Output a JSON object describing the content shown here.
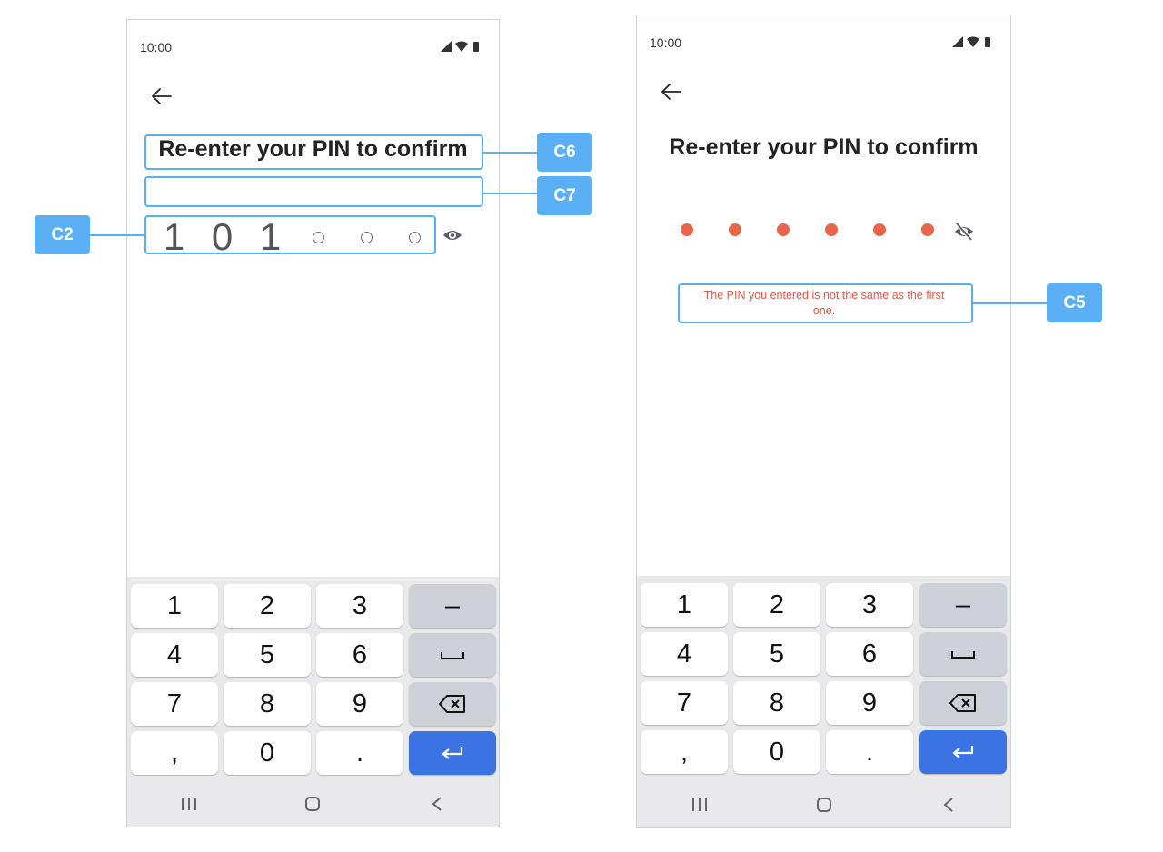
{
  "left_screen": {
    "status_time": "10:00",
    "title": "Re-enter your PIN to confirm",
    "pin_digits": [
      "1",
      "0",
      "1"
    ],
    "empty_slot_count": 3
  },
  "right_screen": {
    "status_time": "10:00",
    "title": "Re-enter your PIN to confirm",
    "masked_slot_count": 6,
    "error_message_line1": "The PIN you entered is not the same as the first",
    "error_message_line2": "one."
  },
  "keyboard": {
    "rows": [
      [
        "1",
        "2",
        "3",
        "–"
      ],
      [
        "4",
        "5",
        "6",
        "space-icon"
      ],
      [
        "7",
        "8",
        "9",
        "backspace-icon"
      ],
      [
        ",",
        "0",
        ".",
        "enter-icon"
      ]
    ]
  },
  "annotations": {
    "c6": "C6",
    "c7": "C7",
    "c2": "C2",
    "c5": "C5"
  },
  "colors": {
    "accent_blue": "#5bb0f5",
    "error_red": "#e05a40",
    "enter_key": "#3b73e2",
    "pin_dot": "#e8654a"
  }
}
